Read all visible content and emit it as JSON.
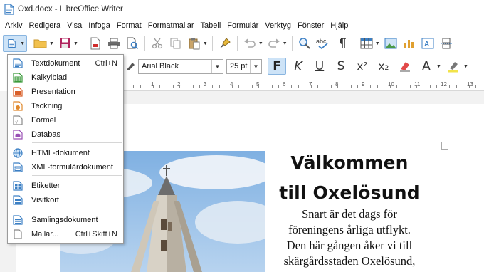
{
  "window": {
    "title": "Oxd.docx - LibreOffice Writer"
  },
  "menubar": [
    "Arkiv",
    "Redigera",
    "Visa",
    "Infoga",
    "Format",
    "Formatmallar",
    "Tabell",
    "Formulär",
    "Verktyg",
    "Fönster",
    "Hjälp"
  ],
  "formatting": {
    "font_name": "Arial Black",
    "font_size": "25 pt",
    "bold_label": "F",
    "italic_label": "K",
    "underline_label": "U",
    "strike_label": "S",
    "superscript_label": "x²",
    "subscript_label": "x₂",
    "font_color_label": "A"
  },
  "ruler": {
    "numbers": [
      "1",
      "2",
      "3",
      "4",
      "5",
      "6",
      "7",
      "8",
      "9",
      "10",
      "11",
      "12",
      "13"
    ]
  },
  "new_menu": {
    "items": [
      {
        "label": "Textdokument",
        "accel": "Ctrl+N",
        "icon": "writer-doc-icon",
        "color": "#3b7fc4"
      },
      {
        "label": "Kalkylblad",
        "accel": "",
        "icon": "calc-sheet-icon",
        "color": "#3a9a3a"
      },
      {
        "label": "Presentation",
        "accel": "",
        "icon": "impress-presentation-icon",
        "color": "#d9602a"
      },
      {
        "label": "Teckning",
        "accel": "",
        "icon": "draw-drawing-icon",
        "color": "#e0882c"
      },
      {
        "label": "Formel",
        "accel": "",
        "icon": "math-formula-icon",
        "color": "#8a8a8a"
      },
      {
        "label": "Databas",
        "accel": "",
        "icon": "base-database-icon",
        "color": "#9a4fb5"
      },
      {
        "label": "HTML-dokument",
        "accel": "",
        "icon": "globe-icon",
        "color": "#3b7fc4"
      },
      {
        "label": "XML-formulärdokument",
        "accel": "",
        "icon": "xml-form-icon",
        "color": "#3b7fc4"
      },
      {
        "label": "Etiketter",
        "accel": "",
        "icon": "labels-icon",
        "color": "#3b7fc4"
      },
      {
        "label": "Visitkort",
        "accel": "",
        "icon": "business-card-icon",
        "color": "#3b7fc4"
      },
      {
        "label": "Samlingsdokument",
        "accel": "",
        "icon": "master-doc-icon",
        "color": "#3b7fc4"
      },
      {
        "label": "Mallar...",
        "accel": "Ctrl+Skift+N",
        "icon": "blank-doc-icon",
        "color": "#888888"
      }
    ]
  },
  "document": {
    "heading_line1": "Välkommen",
    "heading_line2": "till Oxelösund",
    "body_lines": [
      "Snart är det dags för",
      "föreningens årliga utflykt.",
      "Den här gången åker vi till",
      "skärgårdsstaden Oxelösund,"
    ]
  },
  "colors": {
    "accent": "#cde3f7",
    "accent_border": "#89b5e0",
    "sky": "#8fb8e4"
  }
}
